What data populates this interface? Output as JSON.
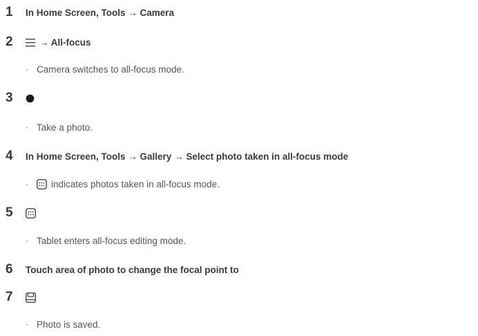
{
  "steps": [
    {
      "number": "1",
      "text": "In Home Screen, Tools → Camera"
    },
    {
      "number": "2",
      "icon": "menu-icon",
      "text": "→ All-focus",
      "sub": {
        "bullet": "·",
        "text": "Camera switches to all-focus mode."
      }
    },
    {
      "number": "3",
      "icon": "shutter-icon",
      "sub": {
        "bullet": "·",
        "text": "Take a photo."
      }
    },
    {
      "number": "4",
      "text": "In Home Screen, Tools → Gallery → Select photo taken in all-focus mode",
      "sub": {
        "bullet": "·",
        "icon": "all-focus-icon",
        "text": "indicates photos taken in all-focus mode."
      }
    },
    {
      "number": "5",
      "icon": "all-focus-icon",
      "sub": {
        "bullet": "·",
        "text": "Tablet enters all-focus editing mode."
      }
    },
    {
      "number": "6",
      "text": "Touch area of photo to change the focal point to"
    },
    {
      "number": "7",
      "icon": "save-icon",
      "sub": {
        "bullet": "·",
        "text": "Photo is saved."
      }
    }
  ],
  "colors": {
    "text": "#3a3a3a",
    "subtext": "#555555"
  }
}
